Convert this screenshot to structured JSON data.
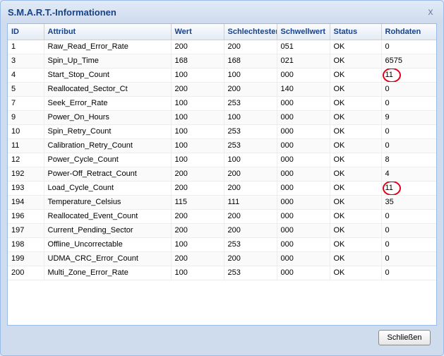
{
  "dialog": {
    "title": "S.M.A.R.T.-Informationen",
    "close_icon": "close-icon",
    "close_glyph": "x",
    "ok_button_label": "Schließen"
  },
  "table": {
    "columns": [
      "ID",
      "Attribut",
      "Wert",
      "Schlechtester",
      "Schwellwert",
      "Status",
      "Rohdaten"
    ],
    "rows": [
      {
        "id": "1",
        "attribut": "Raw_Read_Error_Rate",
        "wert": "200",
        "schlechtester": "200",
        "schwellwert": "051",
        "status": "OK",
        "rohdaten": "0",
        "highlight": false
      },
      {
        "id": "3",
        "attribut": "Spin_Up_Time",
        "wert": "168",
        "schlechtester": "168",
        "schwellwert": "021",
        "status": "OK",
        "rohdaten": "6575",
        "highlight": false
      },
      {
        "id": "4",
        "attribut": "Start_Stop_Count",
        "wert": "100",
        "schlechtester": "100",
        "schwellwert": "000",
        "status": "OK",
        "rohdaten": "11",
        "highlight": true
      },
      {
        "id": "5",
        "attribut": "Reallocated_Sector_Ct",
        "wert": "200",
        "schlechtester": "200",
        "schwellwert": "140",
        "status": "OK",
        "rohdaten": "0",
        "highlight": false
      },
      {
        "id": "7",
        "attribut": "Seek_Error_Rate",
        "wert": "100",
        "schlechtester": "253",
        "schwellwert": "000",
        "status": "OK",
        "rohdaten": "0",
        "highlight": false
      },
      {
        "id": "9",
        "attribut": "Power_On_Hours",
        "wert": "100",
        "schlechtester": "100",
        "schwellwert": "000",
        "status": "OK",
        "rohdaten": "9",
        "highlight": false
      },
      {
        "id": "10",
        "attribut": "Spin_Retry_Count",
        "wert": "100",
        "schlechtester": "253",
        "schwellwert": "000",
        "status": "OK",
        "rohdaten": "0",
        "highlight": false
      },
      {
        "id": "11",
        "attribut": "Calibration_Retry_Count",
        "wert": "100",
        "schlechtester": "253",
        "schwellwert": "000",
        "status": "OK",
        "rohdaten": "0",
        "highlight": false
      },
      {
        "id": "12",
        "attribut": "Power_Cycle_Count",
        "wert": "100",
        "schlechtester": "100",
        "schwellwert": "000",
        "status": "OK",
        "rohdaten": "8",
        "highlight": false
      },
      {
        "id": "192",
        "attribut": "Power-Off_Retract_Count",
        "wert": "200",
        "schlechtester": "200",
        "schwellwert": "000",
        "status": "OK",
        "rohdaten": "4",
        "highlight": false
      },
      {
        "id": "193",
        "attribut": "Load_Cycle_Count",
        "wert": "200",
        "schlechtester": "200",
        "schwellwert": "000",
        "status": "OK",
        "rohdaten": "11",
        "highlight": true
      },
      {
        "id": "194",
        "attribut": "Temperature_Celsius",
        "wert": "115",
        "schlechtester": "111",
        "schwellwert": "000",
        "status": "OK",
        "rohdaten": "35",
        "highlight": false
      },
      {
        "id": "196",
        "attribut": "Reallocated_Event_Count",
        "wert": "200",
        "schlechtester": "200",
        "schwellwert": "000",
        "status": "OK",
        "rohdaten": "0",
        "highlight": false
      },
      {
        "id": "197",
        "attribut": "Current_Pending_Sector",
        "wert": "200",
        "schlechtester": "200",
        "schwellwert": "000",
        "status": "OK",
        "rohdaten": "0",
        "highlight": false
      },
      {
        "id": "198",
        "attribut": "Offline_Uncorrectable",
        "wert": "100",
        "schlechtester": "253",
        "schwellwert": "000",
        "status": "OK",
        "rohdaten": "0",
        "highlight": false
      },
      {
        "id": "199",
        "attribut": "UDMA_CRC_Error_Count",
        "wert": "200",
        "schlechtester": "200",
        "schwellwert": "000",
        "status": "OK",
        "rohdaten": "0",
        "highlight": false
      },
      {
        "id": "200",
        "attribut": "Multi_Zone_Error_Rate",
        "wert": "100",
        "schlechtester": "253",
        "schwellwert": "000",
        "status": "OK",
        "rohdaten": "0",
        "highlight": false
      }
    ]
  }
}
